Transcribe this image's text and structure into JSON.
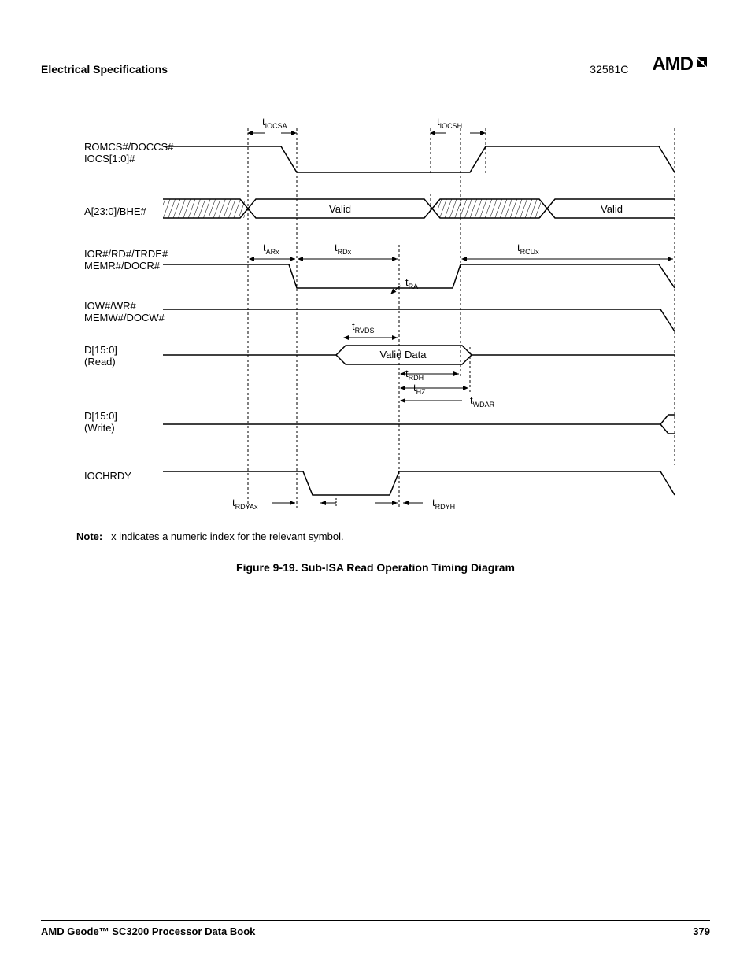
{
  "header": {
    "section": "Electrical Specifications",
    "docnum": "32581C",
    "logo": "AMD"
  },
  "diagram": {
    "signals": {
      "romcs_line1": "ROMCS#/DOCCS#",
      "romcs_line2": "IOCS[1:0]#",
      "addr": "A[23:0]/BHE#",
      "ior_line1": "IOR#/RD#/TRDE#",
      "ior_line2": "MEMR#/DOCR#",
      "iow_line1": "IOW#/WR#",
      "iow_line2": "MEMW#/DOCW#",
      "d_read_line1": "D[15:0]",
      "d_read_line2": "(Read)",
      "d_write_line1": "D[15:0]",
      "d_write_line2": "(Write)",
      "iochrdy": "IOCHRDY"
    },
    "labels": {
      "t_iocsa": "t",
      "t_iocsa_sub": "IOCSA",
      "t_iocsh": "t",
      "t_iocsh_sub": "IOCSH",
      "valid": "Valid",
      "valid_data": "Valid Data",
      "t_arx": "t",
      "t_arx_sub": "ARx",
      "t_rdx": "t",
      "t_rdx_sub": "RDx",
      "t_rcux": "t",
      "t_rcux_sub": "RCUx",
      "t_ra": "t",
      "t_ra_sub": "RA",
      "t_rvds": "t",
      "t_rvds_sub": "RVDS",
      "t_rdh": "t",
      "t_rdh_sub": "RDH",
      "t_hz": "t",
      "t_hz_sub": "HZ",
      "t_wdar": "t",
      "t_wdar_sub": "WDAR",
      "t_rdyax": "t",
      "t_rdyax_sub": "RDYAx",
      "t_rdyh": "t",
      "t_rdyh_sub": "RDYH"
    }
  },
  "note": {
    "label": "Note:",
    "text": "x indicates a numeric index for the relevant symbol."
  },
  "figure_caption": "Figure 9-19.  Sub-ISA Read Operation Timing Diagram",
  "footer": {
    "book": "AMD Geode™ SC3200 Processor Data Book",
    "page": "379"
  }
}
